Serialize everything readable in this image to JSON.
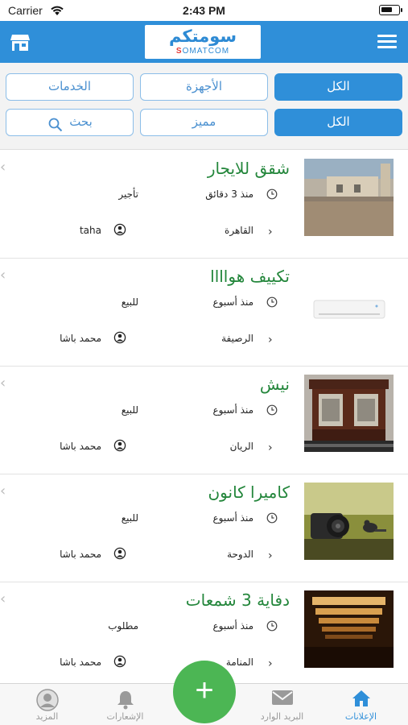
{
  "status_bar": {
    "carrier": "Carrier",
    "time": "2:43 PM",
    "battery_level": 0.65
  },
  "header": {
    "logo_arabic": "سومتكم",
    "logo_latin_first": "S",
    "logo_latin_rest": "OMATCOM",
    "store_icon": "store-icon",
    "menu_icon": "hamburger-menu-icon"
  },
  "filters": {
    "row1": [
      "الكل",
      "الأجهزة",
      "الخدمات"
    ],
    "row2": {
      "all": "الكل",
      "featured": "مميز",
      "search": "بحث"
    }
  },
  "listings": [
    {
      "title": "شقق للايجار",
      "time": "منذ 3 دقائق",
      "type": "تأجير",
      "location": "القاهرة",
      "user": "taha"
    },
    {
      "title": "تكييف هواااا",
      "time": "منذ أسبوع",
      "type": "للبيع",
      "location": "الرصيفة",
      "user": "محمد باشا"
    },
    {
      "title": "نيش",
      "time": "منذ أسبوع",
      "type": "للبيع",
      "location": "الريان",
      "user": "محمد باشا"
    },
    {
      "title": "كاميرا كانون",
      "time": "منذ أسبوع",
      "type": "للبيع",
      "location": "الدوحة",
      "user": "محمد باشا"
    },
    {
      "title": "دفاية 3 شمعات",
      "time": "منذ أسبوع",
      "type": "مطلوب",
      "location": "المنامة",
      "user": "محمد باشا"
    }
  ],
  "tabbar": {
    "ads": "الإعلانات",
    "inbox": "البريد الوارد",
    "add": "+",
    "notifications": "الإشعارات",
    "more": "المزيد"
  },
  "colors": {
    "primary": "#2f8fd9",
    "title_green": "#23863b",
    "fab_green": "#4cb654"
  }
}
